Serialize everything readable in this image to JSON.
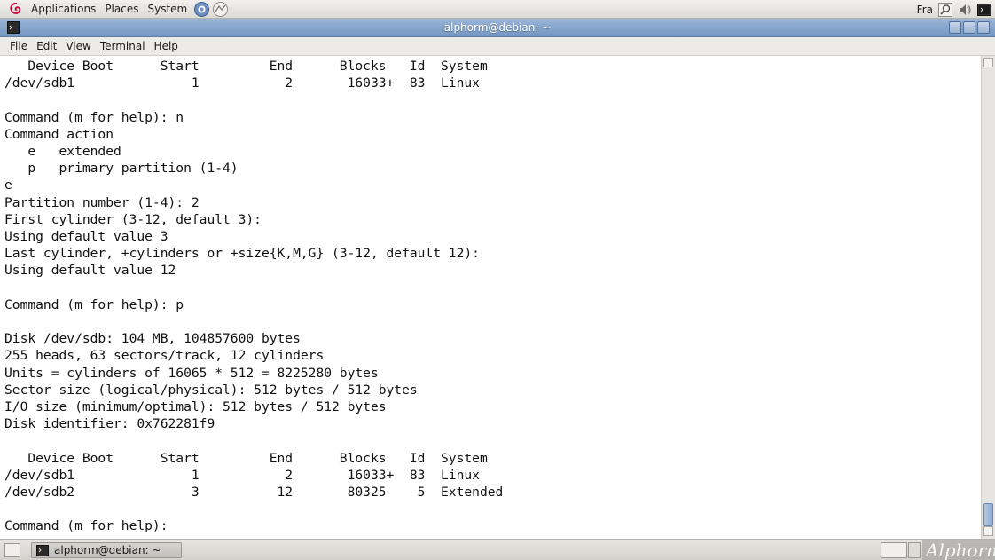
{
  "top_panel": {
    "menus": [
      "Applications",
      "Places",
      "System"
    ],
    "tray": {
      "keyboard_layout": "Fra"
    }
  },
  "window": {
    "title": "alphorm@debian: ~",
    "menubar": [
      {
        "ul": "F",
        "rest": "ile"
      },
      {
        "ul": "E",
        "rest": "dit"
      },
      {
        "ul": "V",
        "rest": "iew"
      },
      {
        "ul": "T",
        "rest": "erminal"
      },
      {
        "ul": "H",
        "rest": "elp"
      }
    ]
  },
  "terminal": {
    "lines": [
      "   Device Boot      Start         End      Blocks   Id  System",
      "/dev/sdb1               1           2       16033+  83  Linux",
      "",
      "Command (m for help): n",
      "Command action",
      "   e   extended",
      "   p   primary partition (1-4)",
      "e",
      "Partition number (1-4): 2",
      "First cylinder (3-12, default 3):",
      "Using default value 3",
      "Last cylinder, +cylinders or +size{K,M,G} (3-12, default 12):",
      "Using default value 12",
      "",
      "Command (m for help): p",
      "",
      "Disk /dev/sdb: 104 MB, 104857600 bytes",
      "255 heads, 63 sectors/track, 12 cylinders",
      "Units = cylinders of 16065 * 512 = 8225280 bytes",
      "Sector size (logical/physical): 512 bytes / 512 bytes",
      "I/O size (minimum/optimal): 512 bytes / 512 bytes",
      "Disk identifier: 0x762281f9",
      "",
      "   Device Boot      Start         End      Blocks   Id  System",
      "/dev/sdb1               1           2       16033+  83  Linux",
      "/dev/sdb2               3          12       80325    5  Extended",
      "",
      "Command (m for help): "
    ]
  },
  "taskbar": {
    "task_label": "alphorm@debian: ~",
    "watermark": "Alphorm"
  },
  "icons": {
    "debian": "debian-swirl-icon",
    "help": "help-icon",
    "network": "network-icon",
    "search": "search-icon",
    "volume": "volume-icon",
    "terminal": "terminal-icon"
  },
  "colors": {
    "titlebar": "#7f9cc8",
    "panel": "#e6e4df",
    "terminal_bg": "#ffffff",
    "terminal_fg": "#111111"
  }
}
